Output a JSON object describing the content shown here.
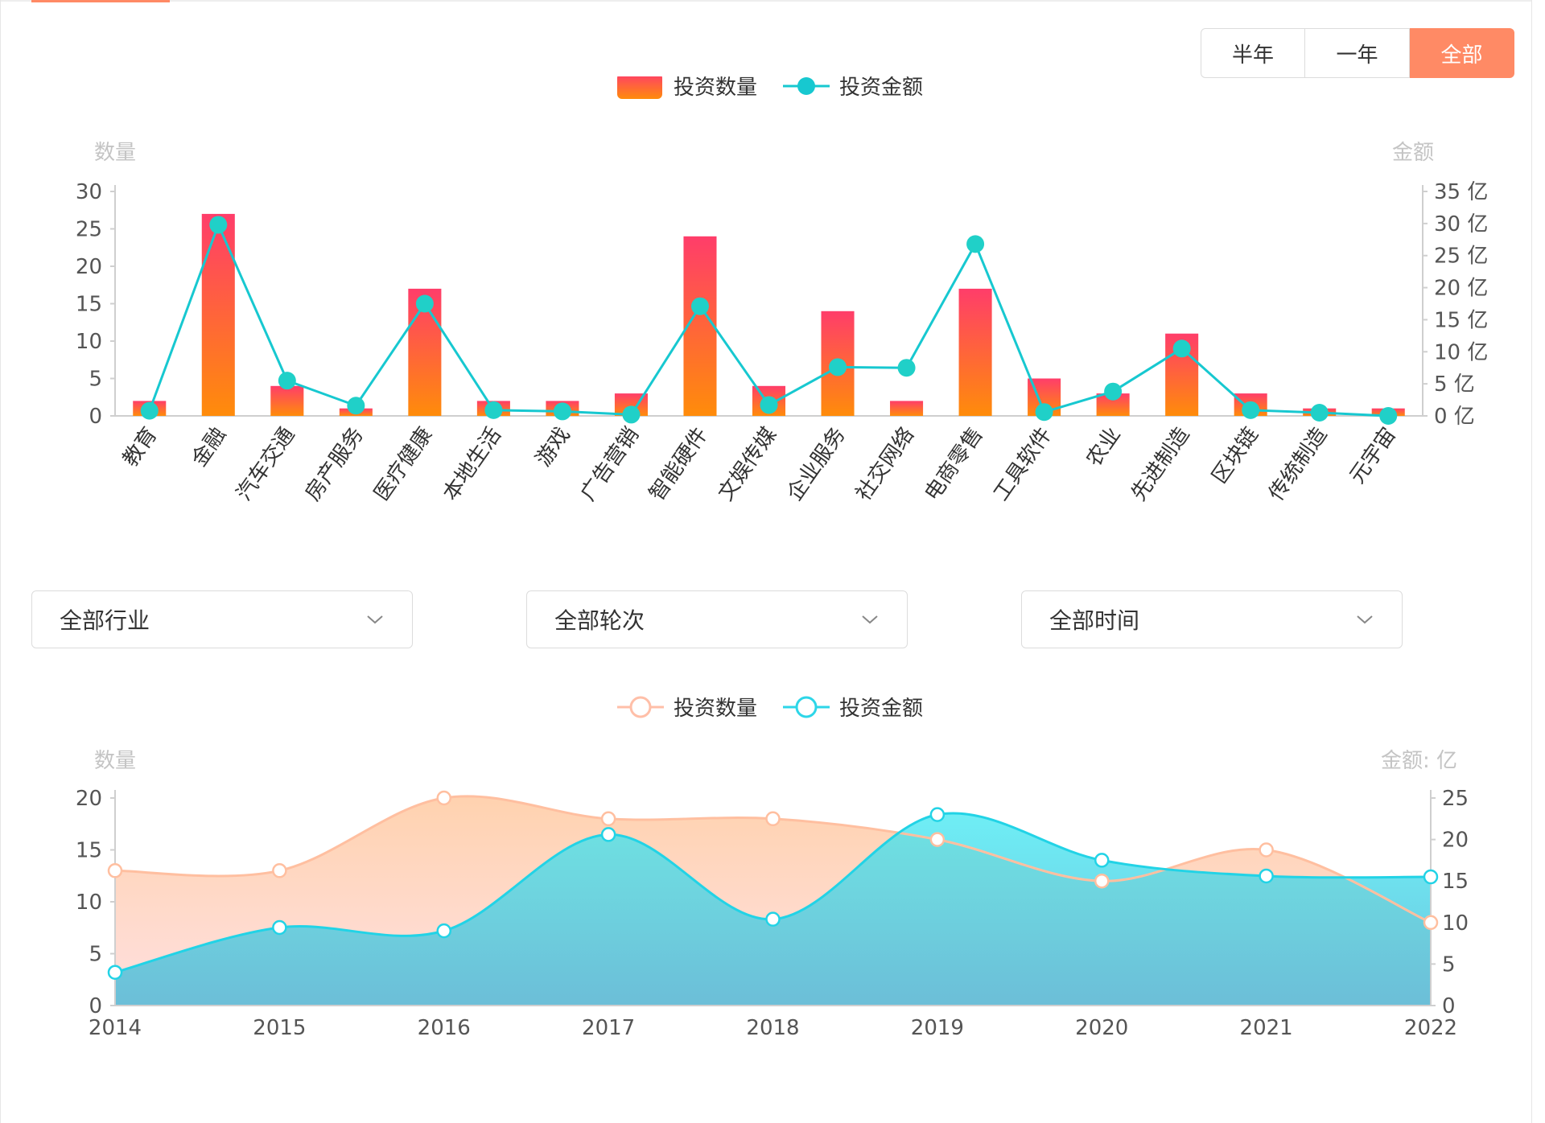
{
  "range_buttons": [
    {
      "label": "半年",
      "active": false
    },
    {
      "label": "一年",
      "active": false
    },
    {
      "label": "全部",
      "active": true
    }
  ],
  "filters": [
    {
      "label": "全部行业"
    },
    {
      "label": "全部轮次"
    },
    {
      "label": "全部时间"
    }
  ],
  "colors": {
    "accent": "#ff8a65",
    "bar_top": "#ff3d6a",
    "bar_bottom": "#ff8c0a",
    "line_teal": "#17c8d0",
    "count_area": "#ffc7a6",
    "amount_area": "#3fe3ef"
  },
  "chart_data": [
    {
      "type": "bar",
      "legend": [
        "投资数量",
        "投资金额"
      ],
      "ylabel_left": "数量",
      "ylabel_right": "金额",
      "y_left_ticks": [
        "0",
        "5",
        "10",
        "15",
        "20",
        "25",
        "30"
      ],
      "y_right_ticks": [
        "0 亿",
        "5 亿",
        "10 亿",
        "15 亿",
        "20 亿",
        "25 亿",
        "30 亿",
        "35 亿"
      ],
      "ylim_left": [
        0,
        30
      ],
      "ylim_right": [
        0,
        35
      ],
      "categories": [
        "教育",
        "金融",
        "汽车交通",
        "房产服务",
        "医疗健康",
        "本地生活",
        "游戏",
        "广告营销",
        "智能硬件",
        "文娱传媒",
        "企业服务",
        "社交网络",
        "电商零售",
        "工具软件",
        "农业",
        "先进制造",
        "区块链",
        "传统制造",
        "元宇宙"
      ],
      "series": [
        {
          "name": "投资数量",
          "kind": "bar",
          "axis": "left",
          "values": [
            2,
            27,
            4,
            1,
            17,
            2,
            2,
            3,
            24,
            4,
            14,
            2,
            17,
            5,
            3,
            11,
            3,
            1,
            1
          ]
        },
        {
          "name": "投资金额",
          "kind": "line",
          "axis": "right",
          "values": [
            0.8,
            29.8,
            5.5,
            1.6,
            17.5,
            0.9,
            0.7,
            0.2,
            17.1,
            1.7,
            7.6,
            7.5,
            26.8,
            0.6,
            3.8,
            10.5,
            0.9,
            0.5,
            0.0
          ]
        }
      ]
    },
    {
      "type": "area",
      "legend": [
        "投资数量",
        "投资金额"
      ],
      "ylabel_left": "数量",
      "ylabel_right": "金额: 亿",
      "y_left_ticks": [
        "0",
        "5",
        "10",
        "15",
        "20"
      ],
      "y_right_ticks": [
        "0",
        "5",
        "10",
        "15",
        "20",
        "25"
      ],
      "ylim_left": [
        0,
        20
      ],
      "ylim_right": [
        0,
        25
      ],
      "x": [
        "2014",
        "2015",
        "2016",
        "2017",
        "2018",
        "2019",
        "2020",
        "2021",
        "2022"
      ],
      "series": [
        {
          "name": "投资数量",
          "axis": "left",
          "values": [
            13,
            13,
            20,
            18,
            18,
            16,
            12,
            15,
            8
          ]
        },
        {
          "name": "投资金额",
          "axis": "right",
          "values": [
            4,
            9.4,
            9,
            20.6,
            10.4,
            23,
            17.5,
            15.6,
            15.5
          ]
        }
      ]
    }
  ]
}
